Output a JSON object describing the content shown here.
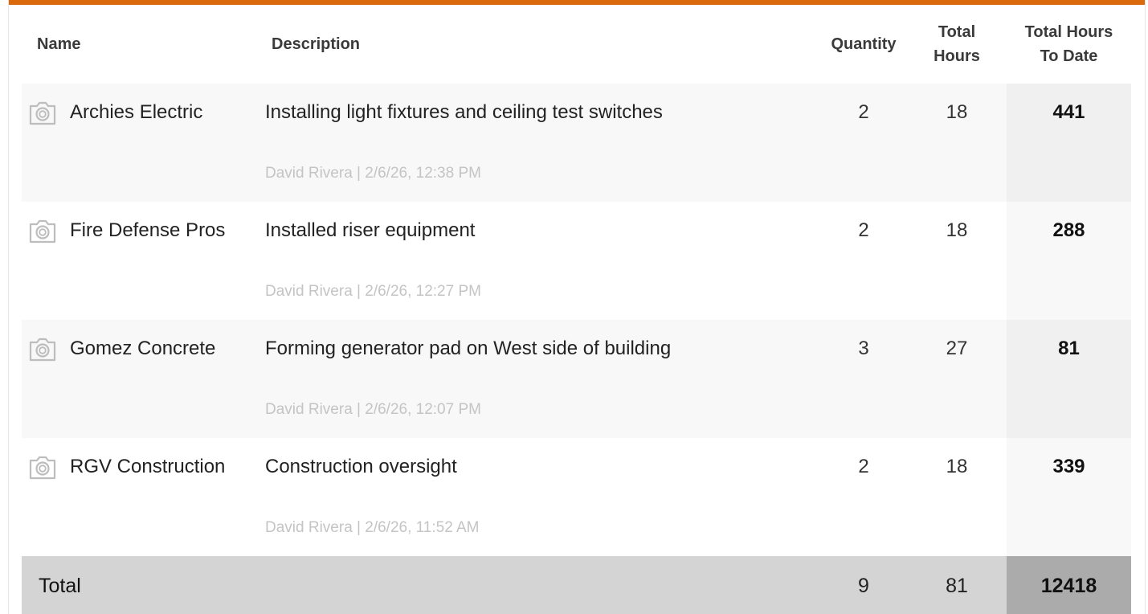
{
  "headers": {
    "name": "Name",
    "description": "Description",
    "quantity": "Quantity",
    "total_hours_1": "Total",
    "total_hours_2": "Hours",
    "to_date_1": "Total Hours",
    "to_date_2": "To Date"
  },
  "rows": [
    {
      "name": "Archies Electric",
      "description": "Installing light fixtures and ceiling test switches",
      "meta": "David Rivera | 2/6/26, 12:38 PM",
      "quantity": "2",
      "total_hours": "18",
      "to_date": "441"
    },
    {
      "name": "Fire Defense Pros",
      "description": "Installed riser equipment",
      "meta": "David Rivera | 2/6/26, 12:27 PM",
      "quantity": "2",
      "total_hours": "18",
      "to_date": "288"
    },
    {
      "name": "Gomez Concrete",
      "description": "Forming generator pad on West side of building",
      "meta": "David Rivera | 2/6/26, 12:07 PM",
      "quantity": "3",
      "total_hours": "27",
      "to_date": "81"
    },
    {
      "name": "RGV Construction",
      "description": "Construction oversight",
      "meta": "David Rivera | 2/6/26, 11:52 AM",
      "quantity": "2",
      "total_hours": "18",
      "to_date": "339"
    }
  ],
  "total": {
    "label": "Total",
    "quantity": "9",
    "total_hours": "81",
    "to_date": "12418"
  },
  "icons": {
    "row_photo": "camera-icon"
  },
  "colors": {
    "accent": "#d9690b",
    "row_shade": "#f8f8f8",
    "total_bg": "#d4d4d4",
    "total_to_date_bg": "#ababab",
    "meta_text": "#c4c4c4"
  }
}
